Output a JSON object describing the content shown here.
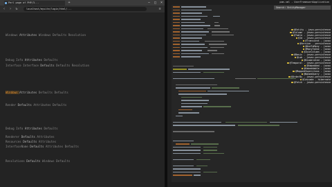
{
  "browser": {
    "tab_title": "Perl page of PHP/3...",
    "url": "localhost/mysite/login/html/...",
    "content_lines": [
      {
        "plain": "Windows ",
        "k": "Attributes ",
        "tail": "Windows Defaults Resolution"
      },
      {
        "plain": "Debug Info ",
        "k": "Attributes ",
        "tail": "Defaults"
      },
      {
        "plain": "Interface Interface ",
        "k": "Defaults ",
        "tail": "Defaults Resolution"
      },
      {
        "plain": "Windows ",
        "k": "Attributes ",
        "tail": "Defaults Defaults"
      },
      {
        "plain": "Render ",
        "k": "Defaults ",
        "tail": "Attributes Defaults"
      },
      {
        "plain": "Debug Info ",
        "k": "Attributes ",
        "tail": "Defaults"
      },
      {
        "plain": "Renderer ",
        "k": "Defaults ",
        "tail": "Attributes"
      },
      {
        "plain": "Resources ",
        "k": "Defaults ",
        "tail": "Attributes"
      },
      {
        "plain": "InterfaceName ",
        "k": "Defaults ",
        "tail": "Attributes Defaults"
      },
      {
        "plain": "Resolutions ",
        "k": "Defaults ",
        "tail": "Windows Defaults"
      }
    ]
  },
  "editor": {
    "title": "pom.xml - UserFrameworkApplication",
    "search_text": "Search: EntityManager",
    "suggestions": [
      "@Entity - java.persistence",
      "@Column - javax.persistence",
      "@Table - javax.persistence",
      "@Id - javax.persistence",
      "@Transient - javax",
      "@Version - persistence",
      "@OneToMany - javax",
      "@ManyToOne - javax",
      "@JoinColumn - javax",
      "@Basic - javax.persistence",
      "@Lob - javax.persistence",
      "@Enumerated - javax",
      "@Temporal - javax.persistence",
      "@Embedded - javax",
      "@Embeddable - javax",
      "@MappedSuperclass - javax",
      "@NamedQuery - javax",
      "@OrderBy - javax.persistence",
      "@Cascade - hibernate",
      "@Fetch - javax.persistence"
    ]
  }
}
